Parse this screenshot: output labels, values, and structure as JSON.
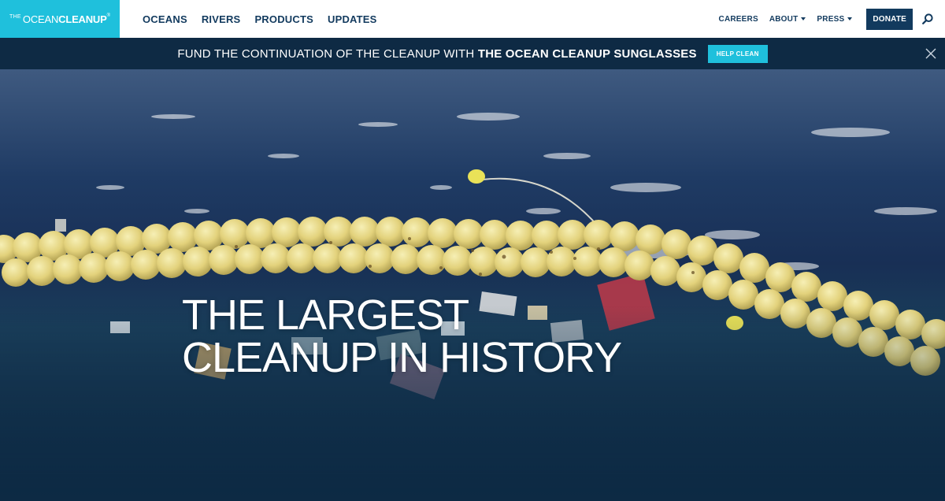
{
  "logo": {
    "the": "THE",
    "ocean": "OCEAN",
    "cleanup": "CLEANUP",
    "tm": "®"
  },
  "main_nav": [
    {
      "label": "OCEANS"
    },
    {
      "label": "RIVERS"
    },
    {
      "label": "PRODUCTS"
    },
    {
      "label": "UPDATES"
    }
  ],
  "right_nav": {
    "careers": "CAREERS",
    "about": "ABOUT",
    "press": "PRESS",
    "donate": "DONATE"
  },
  "banner": {
    "text": "FUND THE CONTINUATION OF THE CLEANUP WITH ",
    "highlight": "THE OCEAN CLEANUP SUNGLASSES",
    "button": "HELP CLEAN"
  },
  "hero": {
    "line1": "THE LARGEST",
    "line2": "CLEANUP IN HISTORY"
  },
  "colors": {
    "brand_cyan": "#1fc0dc",
    "navy": "#123a5e",
    "banner_bg": "#0e2a44"
  },
  "icons": {
    "search": "search-icon",
    "close": "close-icon",
    "dropdown": "chevron-down-icon"
  }
}
